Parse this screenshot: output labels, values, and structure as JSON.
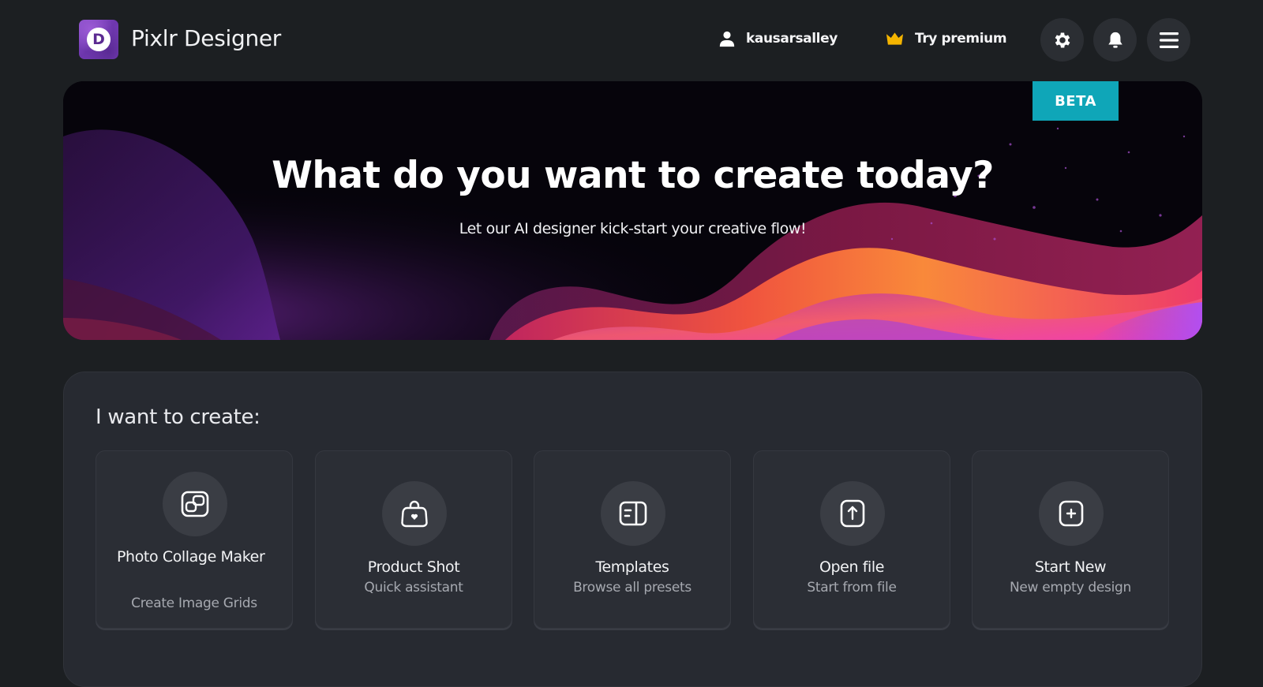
{
  "header": {
    "logo_letter": "D",
    "app_title": "Pixlr Designer",
    "username": "kausarsalley",
    "premium_label": "Try premium",
    "icons": {
      "user": "user-icon",
      "premium": "crown-icon",
      "settings": "gear-icon",
      "notifications": "bell-icon",
      "menu": "hamburger-menu-icon"
    }
  },
  "banner": {
    "title": "What do you want to create today?",
    "subtitle": "Let our AI designer kick-start your creative flow!",
    "badge": "BETA"
  },
  "create_panel": {
    "heading": "I want to create:",
    "cards": [
      {
        "title": "Photo Collage Maker",
        "subtitle": "Create Image Grids",
        "icon": "collage-icon"
      },
      {
        "title": "Product Shot",
        "subtitle": "Quick assistant",
        "icon": "shopping-bag-heart-icon"
      },
      {
        "title": "Templates",
        "subtitle": "Browse all presets",
        "icon": "template-icon"
      },
      {
        "title": "Open file",
        "subtitle": "Start from file",
        "icon": "upload-icon"
      },
      {
        "title": "Start New",
        "subtitle": "New empty design",
        "icon": "plus-square-icon"
      }
    ]
  },
  "colors": {
    "page_background": "#1c1f22",
    "panel_background": "#272a31",
    "card_background": "#2b2e35",
    "beta_badge": "#0fa6b8",
    "crown": "#f4b400",
    "brand_purple": "#7e45bf"
  }
}
